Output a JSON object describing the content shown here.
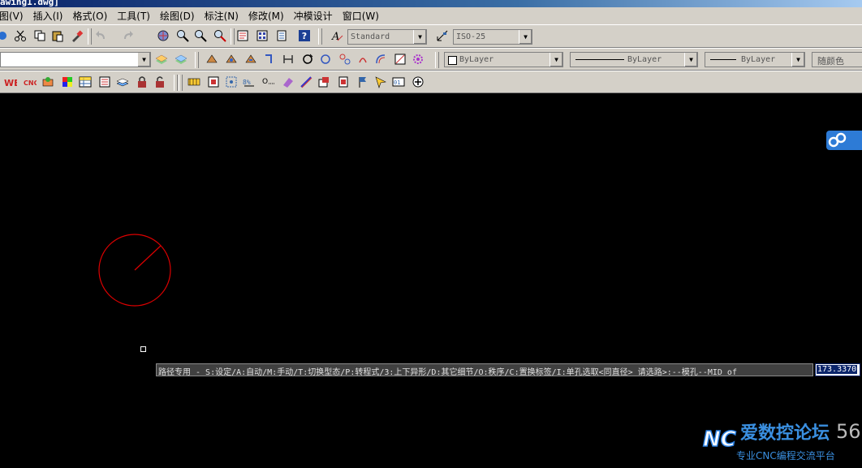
{
  "window": {
    "title": "awing1.dwg]"
  },
  "menu": [
    "图(V)",
    "插入(I)",
    "格式(O)",
    "工具(T)",
    "绘图(D)",
    "标注(N)",
    "修改(M)",
    "冲模设计",
    "窗口(W)"
  ],
  "toolbar": {
    "text_style": "Standard",
    "dim_style": "ISO-25",
    "layer": "",
    "color": "ByLayer",
    "linetype": "ByLayer",
    "lineweight": "ByLayer",
    "plot_style": "随颜色"
  },
  "command": {
    "prompt": "路径专用 - S:设定/A:自动/M:手动/T:切换型态/P:转程式/3:上下异形/D:其它细节/O:秩序/C:置换标签/I:单孔选取<同直径> 请选路>:--模孔--MID of",
    "input_value": "173.3370"
  },
  "drawing": {
    "circle_color": "#ff0000",
    "background": "#000000"
  },
  "watermark": {
    "logo": "NC",
    "title": "爱数控论坛",
    "subtitle": "专业CNC编程交流平台",
    "number": "56"
  }
}
